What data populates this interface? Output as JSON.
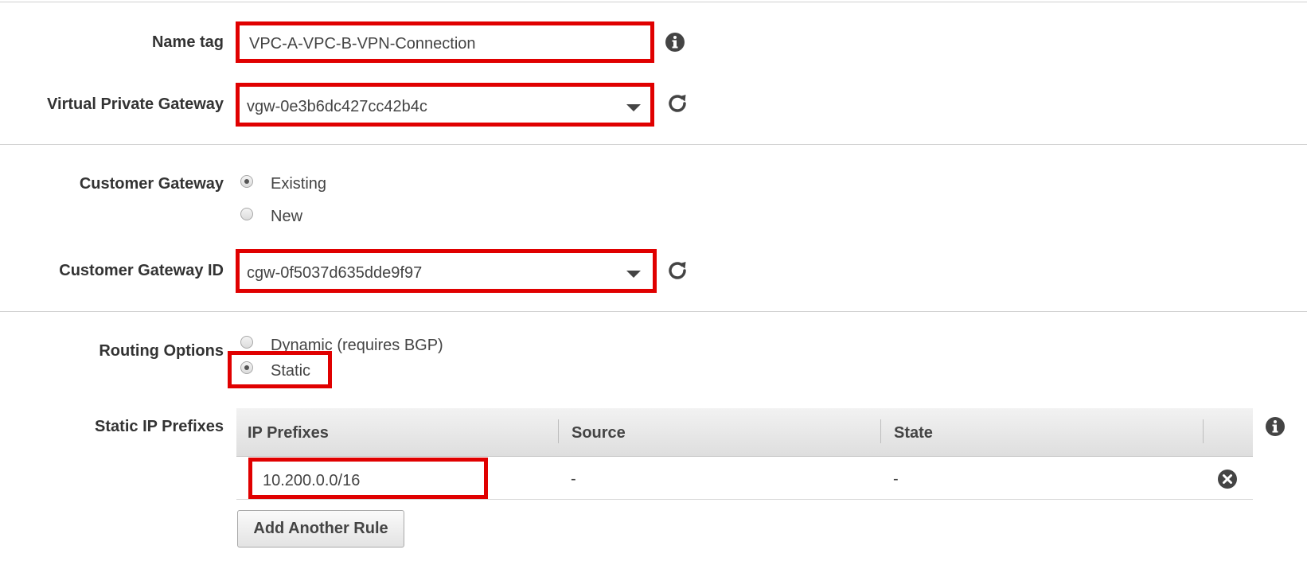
{
  "form": {
    "name_tag": {
      "label": "Name tag",
      "value": "VPC-A-VPC-B-VPN-Connection"
    },
    "virtual_private_gateway": {
      "label": "Virtual Private Gateway",
      "value": "vgw-0e3b6dc427cc42b4c"
    },
    "customer_gateway": {
      "label": "Customer Gateway",
      "options": [
        "Existing",
        "New"
      ],
      "selected": "Existing"
    },
    "customer_gateway_id": {
      "label": "Customer Gateway ID",
      "value": "cgw-0f5037d635dde9f97"
    },
    "routing_options": {
      "label": "Routing Options",
      "options": [
        "Dynamic (requires BGP)",
        "Static"
      ],
      "selected": "Static"
    },
    "static_ip_prefixes": {
      "label": "Static IP Prefixes",
      "columns": [
        "IP Prefixes",
        "Source",
        "State"
      ],
      "rows": [
        {
          "ip_prefix": "10.200.0.0/16",
          "source": "-",
          "state": "-"
        }
      ],
      "add_button": "Add Another Rule"
    }
  },
  "colors": {
    "highlight": "#e00000",
    "text": "#444444",
    "label": "#333333"
  },
  "icons": {
    "info": "info-icon",
    "refresh": "refresh-icon",
    "remove": "remove-icon",
    "dropdown": "caret-down-icon"
  }
}
